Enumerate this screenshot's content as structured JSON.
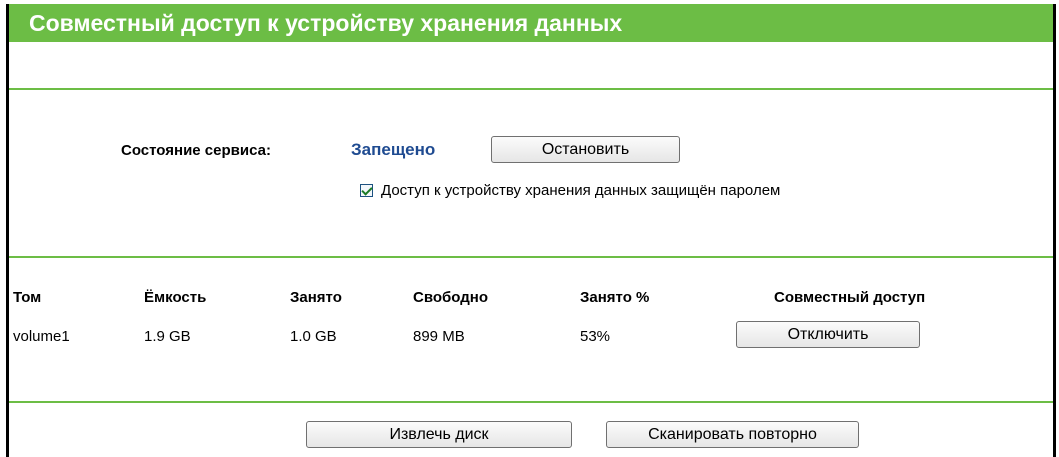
{
  "header": {
    "title": "Совместный доступ к устройству хранения данных"
  },
  "service": {
    "status_label": "Состояние сервиса:",
    "status_value": "Запещено",
    "stop_button": "Остановить",
    "password_checkbox_label": "Доступ к устройству хранения данных защищён паролем",
    "password_checkbox_checked": true
  },
  "table": {
    "columns": [
      "Том",
      "Ёмкость",
      "Занято",
      "Свободно",
      "Занято %",
      "Совместный доступ"
    ],
    "rows": [
      {
        "volume": "volume1",
        "capacity": "1.9 GB",
        "used": "1.0 GB",
        "free": "899 MB",
        "used_percent": "53%",
        "share_button": "Отключить"
      }
    ]
  },
  "footer": {
    "eject_button": "Извлечь диск",
    "rescan_button": "Сканировать повторно"
  },
  "colors": {
    "accent": "#6cbd45",
    "status_value": "#1f4b91"
  }
}
